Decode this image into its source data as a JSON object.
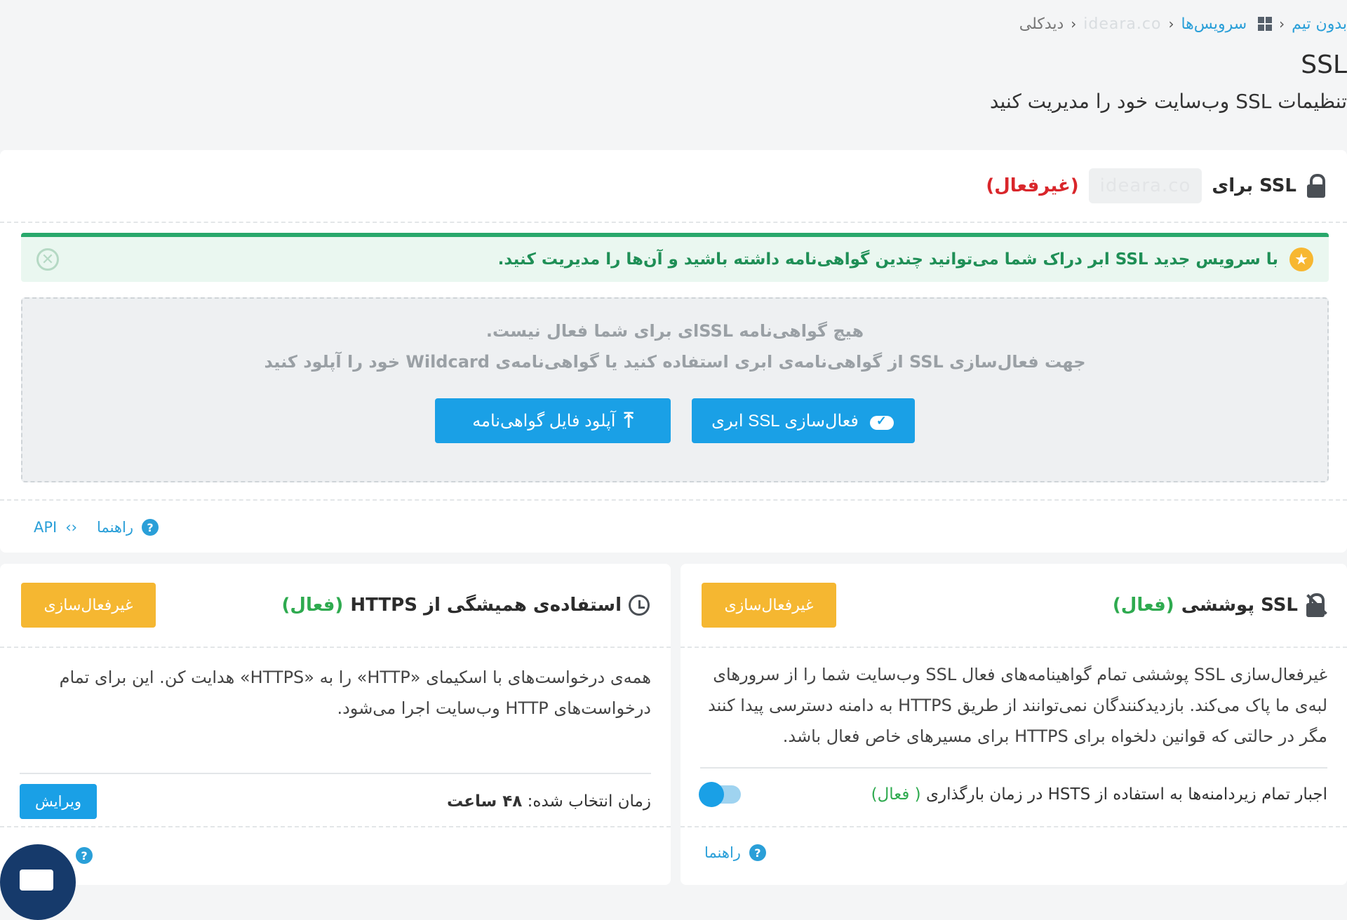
{
  "breadcrumb": {
    "team": "بدون تیم",
    "services": "سرویس‌ها",
    "domain": "ideara.co",
    "current": "دیدکلی"
  },
  "page": {
    "title": "SSL",
    "subtitle": "تنظیمات SSL وب‌سایت خود را مدیریت کنید"
  },
  "ssl_card": {
    "title": "SSL برای",
    "domain": "ideara.co",
    "status": "(غیرفعال)",
    "notice": "با سرویس جدید SSL ابر دراک شما می‌توانید چندین گواهی‌نامه داشته باشید و آن‌ها را مدیریت کنید.",
    "empty_line1": "هیچ گواهی‌نامه SSLای برای شما فعال نیست.",
    "empty_line2": "جهت فعال‌سازی SSL از گواهی‌نامه‌ی ابری استفاده کنید یا گواهی‌نامه‌ی Wildcard خود را آپلود کنید",
    "activate_button": "فعال‌سازی SSL ابری",
    "upload_button": "آپلود فایل گواهی‌نامه",
    "help_link": "راهنما",
    "api_link": "API"
  },
  "https_card": {
    "title": "استفاده‌ی همیشگی از HTTPS",
    "status": "(فعال)",
    "disable_button": "غیرفعال‌سازی",
    "description": "همه‌ی درخواست‌های با اسکیمای «HTTP» را به «HTTPS» هدایت کن. این برای تمام درخواست‌های HTTP وب‌سایت اجرا می‌شود.",
    "time_label": "زمان انتخاب شده:",
    "time_value": "۴۸ ساعت",
    "edit_button": "ویرایش"
  },
  "cover_ssl_card": {
    "title": "SSL پوششی",
    "status": "(فعال)",
    "disable_button": "غیرفعال‌سازی",
    "description": "غیرفعال‌سازی SSL پوششی تمام گواهینامه‌های فعال SSL وب‌سایت شما را از سرورهای لبه‌ی ما پاک می‌کند. بازدیدکنندگان نمی‌توانند از طریق HTTPS به دامنه دسترسی پیدا کنند مگر در حالتی که قوانین دلخواه برای HTTPS برای مسیرهای خاص فعال باشد.",
    "hsts_label": "اجبار تمام زیردامنه‌ها به استفاده از HSTS در زمان بارگذاری",
    "hsts_status": "( فعال)",
    "help_link": "راهنما"
  },
  "colors": {
    "accent": "#1aa0e6",
    "warning": "#f5b731",
    "danger": "#d9262b",
    "success": "#2eaa4f"
  }
}
